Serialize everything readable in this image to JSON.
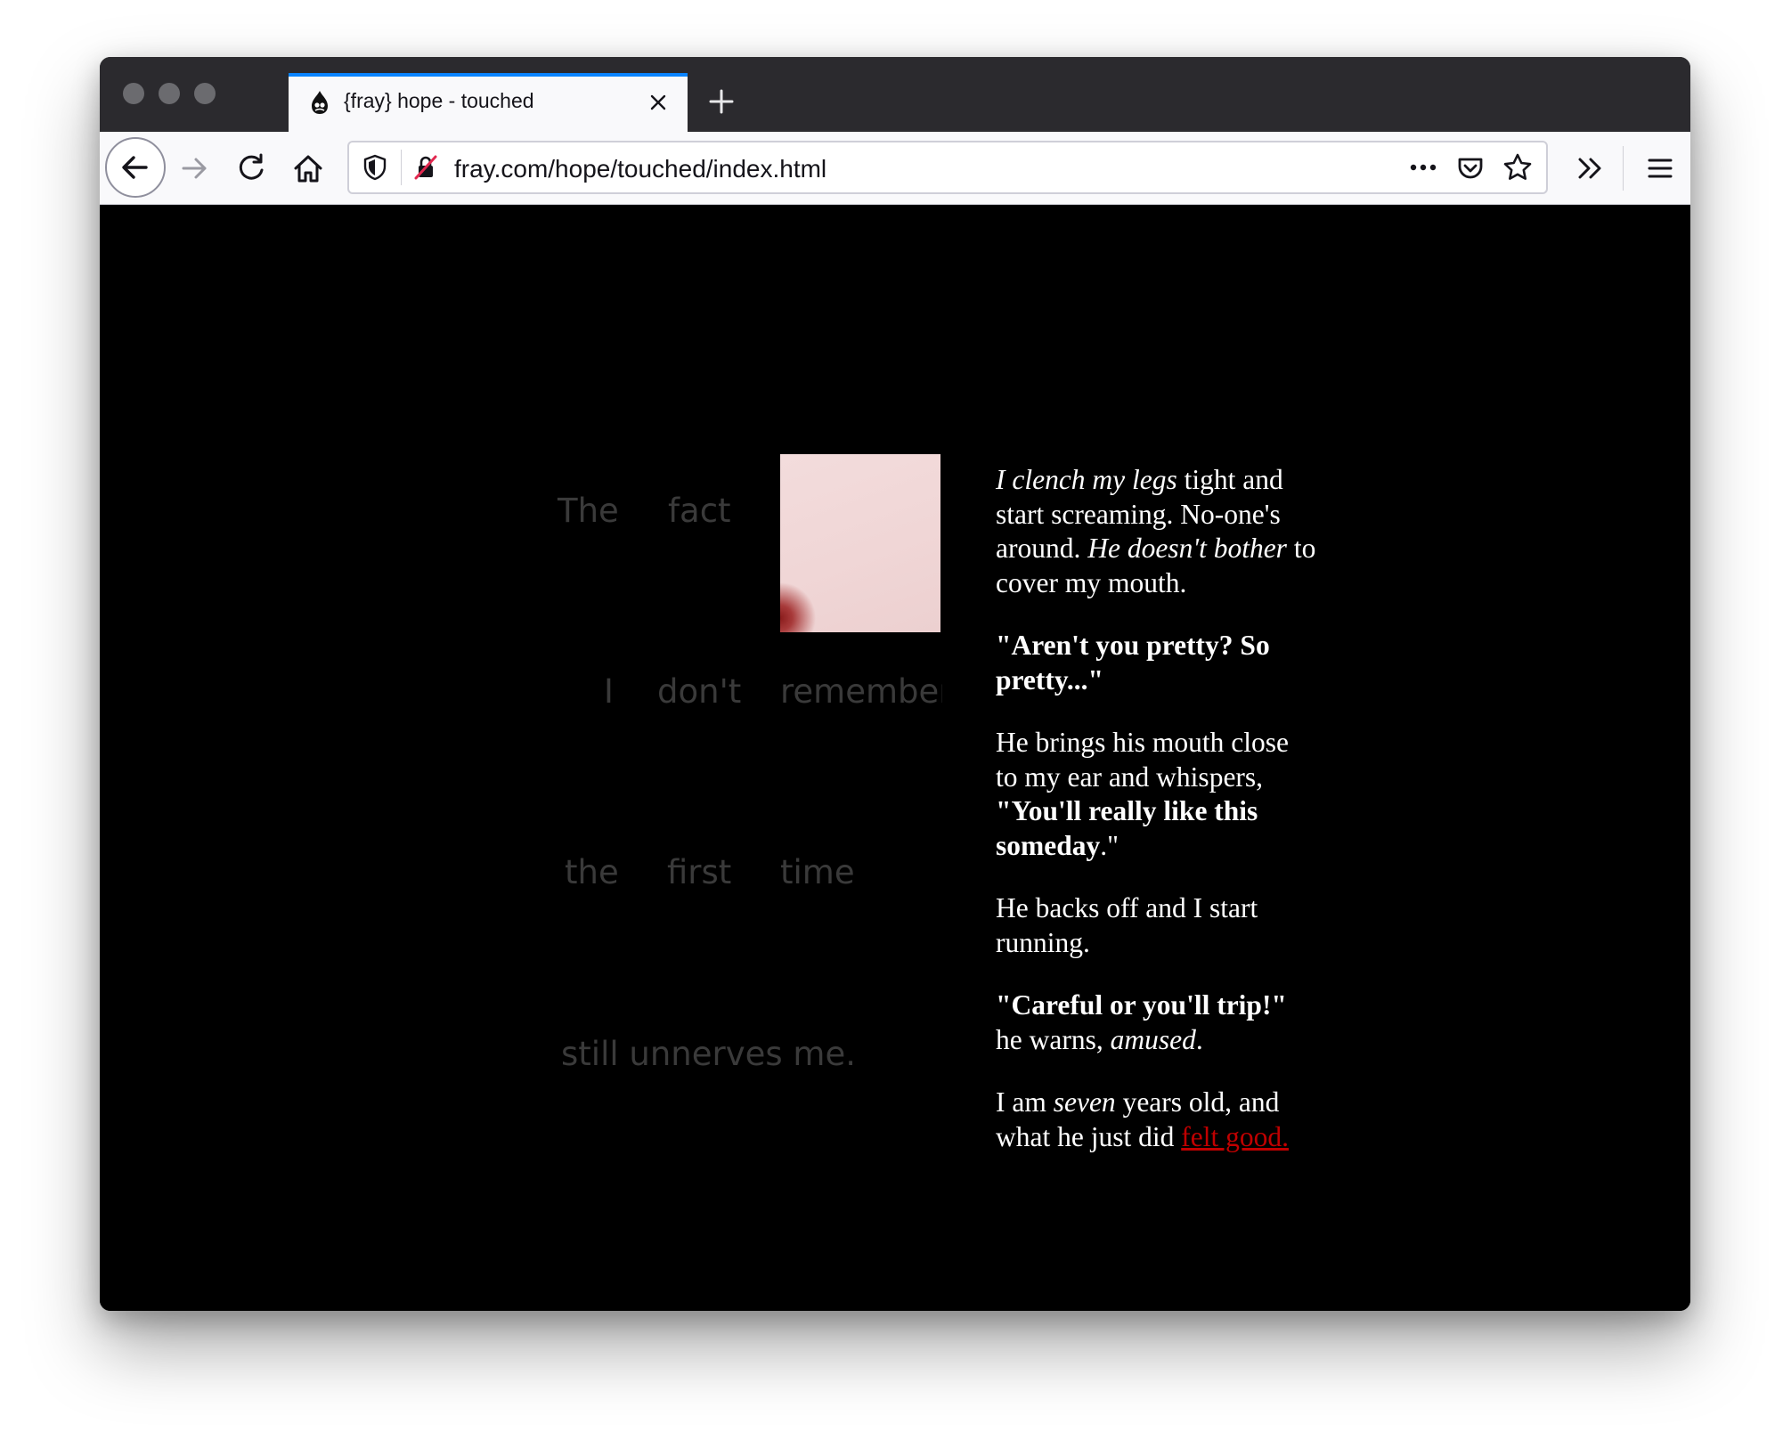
{
  "browser": {
    "tab_title": "{fray} hope - touched",
    "url": "fray.com/hope/touched/index.html"
  },
  "page": {
    "grey_text": {
      "row1": [
        "The",
        "fact"
      ],
      "row2": [
        "I",
        "don't",
        "remember"
      ],
      "row3": [
        "the",
        "first",
        "time"
      ],
      "row4": "still unnerves me."
    },
    "story": {
      "p1": {
        "em1": "I clench my legs",
        "t1": " tight and start screaming. No-one's around. ",
        "em2": "He doesn't bother",
        "t2": " to cover my mouth."
      },
      "p2": {
        "b1": "\"Aren't you pretty? So pretty...\""
      },
      "p3": {
        "t1": "He brings his mouth close to my ear and whispers, ",
        "b1": "\"You'll really like this someday",
        "t2": ".\""
      },
      "p4": {
        "t1": "He backs off and I start running."
      },
      "p5": {
        "b1": "\"Careful or you'll trip!\"",
        "t1": " he warns, ",
        "em1": "amused",
        "t2": "."
      },
      "p6": {
        "t1": "I am ",
        "em1": "seven",
        "t2": " years old, and what he just did ",
        "link": "felt good."
      }
    }
  }
}
